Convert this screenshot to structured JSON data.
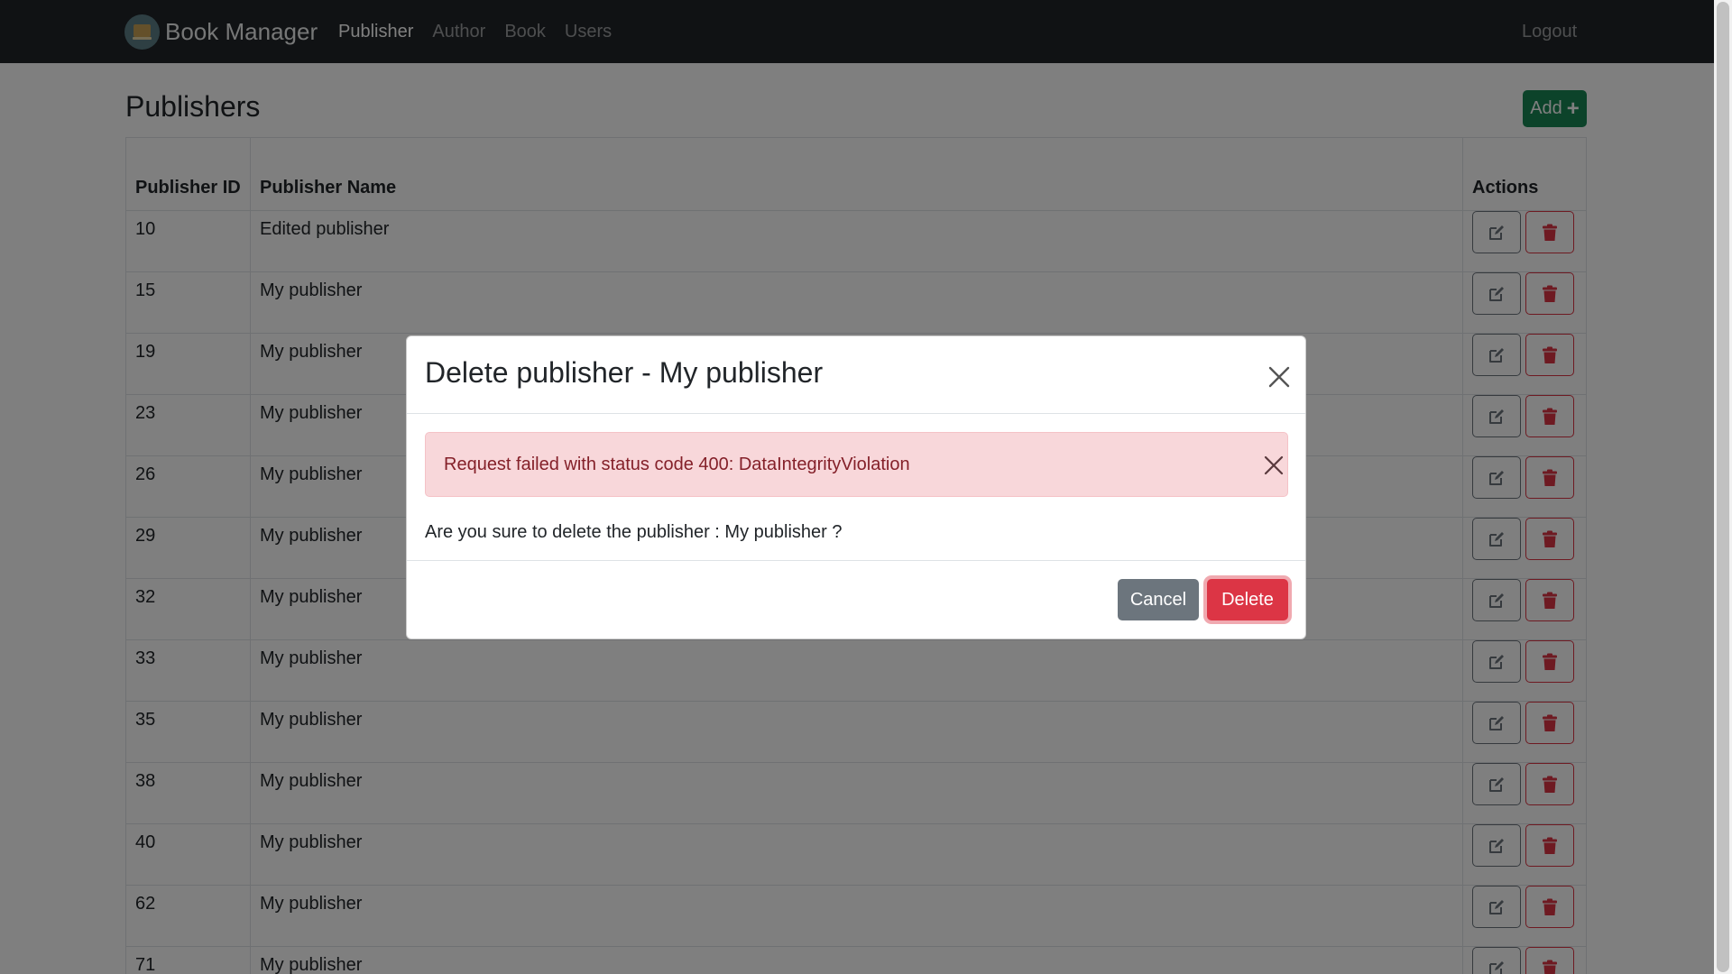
{
  "navbar": {
    "brand": "Book Manager",
    "links": [
      {
        "label": "Publisher",
        "active": true
      },
      {
        "label": "Author",
        "active": false
      },
      {
        "label": "Book",
        "active": false
      },
      {
        "label": "Users",
        "active": false
      }
    ],
    "logout": "Logout"
  },
  "page": {
    "title": "Publishers",
    "add_label": "Add",
    "add_icon": "plus-icon"
  },
  "table": {
    "headers": {
      "id": "Publisher ID",
      "name": "Publisher Name",
      "actions": "Actions"
    },
    "rows": [
      {
        "id": "10",
        "name": "Edited publisher"
      },
      {
        "id": "15",
        "name": "My publisher"
      },
      {
        "id": "19",
        "name": "My publisher"
      },
      {
        "id": "23",
        "name": "My publisher"
      },
      {
        "id": "26",
        "name": "My publisher"
      },
      {
        "id": "29",
        "name": "My publisher"
      },
      {
        "id": "32",
        "name": "My publisher"
      },
      {
        "id": "33",
        "name": "My publisher"
      },
      {
        "id": "35",
        "name": "My publisher"
      },
      {
        "id": "38",
        "name": "My publisher"
      },
      {
        "id": "40",
        "name": "My publisher"
      },
      {
        "id": "62",
        "name": "My publisher"
      },
      {
        "id": "71",
        "name": "My publisher"
      }
    ],
    "row_actions": {
      "edit_icon": "edit-icon",
      "delete_icon": "trash-icon"
    }
  },
  "modal": {
    "title": "Delete publisher - My publisher",
    "alert": "Request failed with status code 400: DataIntegrityViolation",
    "confirm": "Are you sure to delete the publisher : My publisher ?",
    "cancel_label": "Cancel",
    "delete_label": "Delete"
  },
  "colors": {
    "navbar": "#212529",
    "success": "#198754",
    "danger": "#dc3545",
    "secondary": "#6c757d",
    "alert_bg": "#f8d7da",
    "alert_text": "#842029"
  }
}
